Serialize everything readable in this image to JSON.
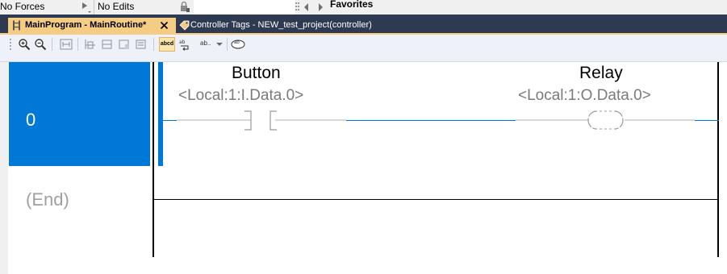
{
  "status_bar": {
    "force_status": "No Forces",
    "edit_status": "No Edits",
    "favorites_label": "Favorites"
  },
  "tabs": [
    {
      "label": "MainProgram - MainRoutine*",
      "active": true
    },
    {
      "label": "Controller Tags - NEW_test_project(controller)",
      "active": false
    }
  ],
  "toolbar": {
    "icons": [
      "zoom-in-icon",
      "zoom-out-icon",
      "verify-icon",
      "rung-icon",
      "branch-icon",
      "branch-level-icon",
      "element-icon",
      "text-toggle-icon",
      "wrap-icon",
      "description-dropdown-icon",
      "comment-icon"
    ],
    "text_toggle_label": "abcd",
    "abbrev_label": "ab..",
    "comment_label": "ab"
  },
  "ladder": {
    "rungs": [
      {
        "number": "0",
        "instructions": [
          {
            "type": "XIC",
            "description": "Button",
            "operand": "<Local:1:I.Data.0>"
          },
          {
            "type": "OTE",
            "description": "Relay",
            "operand": "<Local:1:O.Data.0>"
          }
        ]
      }
    ],
    "end_label": "(End)"
  },
  "colors": {
    "tab_bar": "#2d3a52",
    "active_tab": "#f5cc84",
    "selection": "#0078d7",
    "operand_text": "#7a7a7a"
  }
}
